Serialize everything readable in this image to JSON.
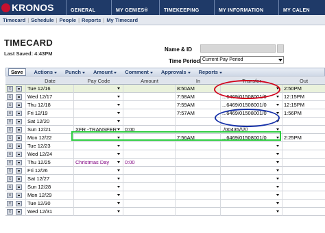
{
  "app": {
    "logo_text": "KRONOS"
  },
  "nav_tabs": [
    "GENERAL",
    "MY GENIES®",
    "TIMEKEEPING",
    "MY INFORMATION",
    "MY CALEN"
  ],
  "subnav": [
    "Timecard",
    "Schedule",
    "People",
    "Reports",
    "My Timecard"
  ],
  "page": {
    "title": "TIMECARD",
    "last_saved": "Last Saved: 4:43PM"
  },
  "filters": {
    "name_id_label": "Name & ID",
    "name_id_value": "",
    "time_period_label": "Time Period",
    "time_period_value": "Current Pay Period"
  },
  "toolbar": {
    "save_label": "Save",
    "menus": [
      "Actions",
      "Punch",
      "Amount",
      "Comment",
      "Approvals",
      "Reports"
    ]
  },
  "columns": {
    "date": "Date",
    "pay_code": "Pay Code",
    "amount": "Amount",
    "in": "In",
    "transfer": "Transfer",
    "out": "Out"
  },
  "rows": [
    {
      "date": "Tue 12/16",
      "pay_code": "",
      "amount": "",
      "in": "8:50AM",
      "transfer": "",
      "out": "2:50PM",
      "highlight": true
    },
    {
      "date": "Wed 12/17",
      "pay_code": "",
      "amount": "",
      "in": "7:58AM",
      "transfer": "...6469/01508001/0",
      "out": "12:15PM"
    },
    {
      "date": "Thu 12/18",
      "pay_code": "",
      "amount": "",
      "in": "7:59AM",
      "transfer": "...6469/01508001/0",
      "out": "12:15PM"
    },
    {
      "date": "Fri 12/19",
      "pay_code": "",
      "amount": "",
      "in": "7:57AM",
      "transfer": "...6469/01508001/0",
      "out": "1:56PM"
    },
    {
      "date": "Sat 12/20",
      "pay_code": "",
      "amount": "",
      "in": "",
      "transfer": "",
      "out": ""
    },
    {
      "date": "Sun 12/21",
      "pay_code": "XFR -TRANSFER",
      "amount": "0:00",
      "in": "",
      "transfer": ",/00435//////",
      "out": ""
    },
    {
      "date": "Mon 12/22",
      "pay_code": "",
      "amount": "",
      "in": "7:56AM",
      "transfer": "...6469/01508001/0",
      "out": "2:25PM"
    },
    {
      "date": "Tue 12/23",
      "pay_code": "",
      "amount": "",
      "in": "",
      "transfer": "",
      "out": ""
    },
    {
      "date": "Wed 12/24",
      "pay_code": "",
      "amount": "",
      "in": "",
      "transfer": "",
      "out": ""
    },
    {
      "date": "Thu 12/25",
      "pay_code": "Christmas Day",
      "amount": "0:00",
      "in": "",
      "transfer": "",
      "out": "",
      "purple": true
    },
    {
      "date": "Fri 12/26",
      "pay_code": "",
      "amount": "",
      "in": "",
      "transfer": "",
      "out": ""
    },
    {
      "date": "Sat 12/27",
      "pay_code": "",
      "amount": "",
      "in": "",
      "transfer": "",
      "out": ""
    },
    {
      "date": "Sun 12/28",
      "pay_code": "",
      "amount": "",
      "in": "",
      "transfer": "",
      "out": ""
    },
    {
      "date": "Mon 12/29",
      "pay_code": "",
      "amount": "",
      "in": "",
      "transfer": "",
      "out": ""
    },
    {
      "date": "Tue 12/30",
      "pay_code": "",
      "amount": "",
      "in": "",
      "transfer": "",
      "out": ""
    },
    {
      "date": "Wed 12/31",
      "pay_code": "",
      "amount": "",
      "in": "",
      "transfer": "",
      "out": ""
    }
  ],
  "icons": {
    "row_delete": "x-icon",
    "row_detail": "details-icon",
    "dropdown": "chevron-down-icon"
  },
  "colors": {
    "nav_bg": "#1f3a68",
    "highlight_row": "#eaf2dc",
    "annotation_red": "#d0021b",
    "annotation_blue": "#1631a8",
    "annotation_green": "#2ecc40"
  }
}
